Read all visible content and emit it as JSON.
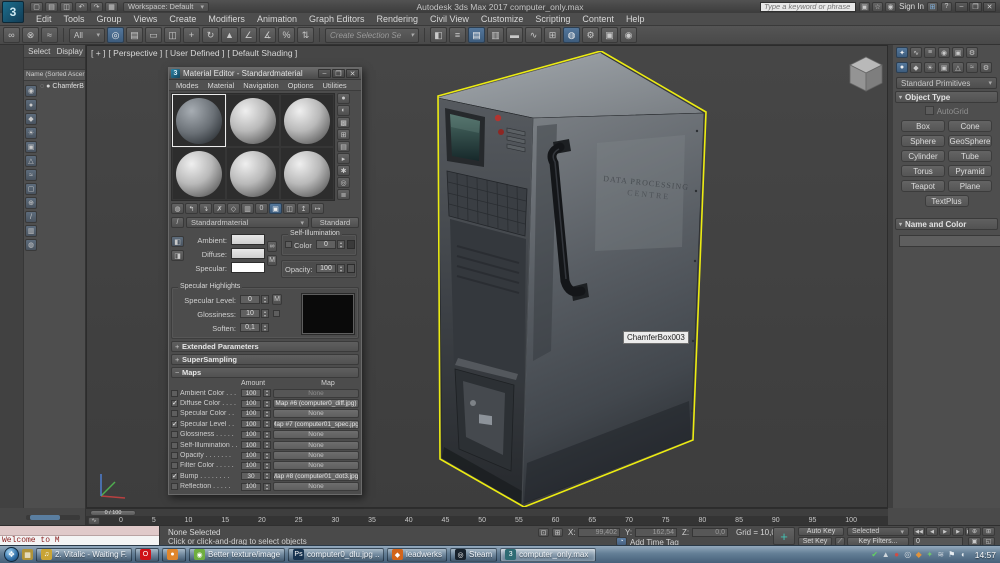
{
  "titlebar": {
    "workspace": "Workspace: Default",
    "title": "Autodesk 3ds Max 2017   computer_only.max",
    "search_placeholder": "Type a keyword or phrase",
    "sign_in": "Sign In",
    "quick_icons": [
      {
        "name": "new-scene-icon",
        "glyph": "▢"
      },
      {
        "name": "open-file-icon",
        "glyph": "▤"
      },
      {
        "name": "save-file-icon",
        "glyph": "◫"
      },
      {
        "name": "undo-icon",
        "glyph": "↶"
      },
      {
        "name": "redo-icon",
        "glyph": "↷"
      },
      {
        "name": "project-folder-icon",
        "glyph": "▦"
      }
    ],
    "right_icons": [
      {
        "name": "communication-center-icon",
        "glyph": "▣"
      },
      {
        "name": "favorites-icon",
        "glyph": "☆"
      },
      {
        "name": "profile-icon",
        "glyph": "◉"
      }
    ],
    "window_buttons": [
      {
        "name": "minimize-button",
        "glyph": "–"
      },
      {
        "name": "restore-button",
        "glyph": "❐"
      },
      {
        "name": "close-button",
        "glyph": "✕"
      }
    ]
  },
  "menubar": {
    "items": [
      "Edit",
      "Tools",
      "Group",
      "Views",
      "Create",
      "Modifiers",
      "Animation",
      "Graph Editors",
      "Rendering",
      "Civil View",
      "Customize",
      "Scripting",
      "Content",
      "Help"
    ]
  },
  "toolbar": {
    "left_icons": [
      {
        "name": "select-and-link-icon",
        "glyph": "∞"
      },
      {
        "name": "unlink-selection-icon",
        "glyph": "⊗"
      },
      {
        "name": "bind-to-space-warp-icon",
        "glyph": "≈"
      }
    ],
    "filter_label": "All",
    "mid_icons": [
      {
        "name": "select-object-icon",
        "glyph": "◎",
        "active": true
      },
      {
        "name": "select-by-name-icon",
        "glyph": "▤"
      },
      {
        "name": "rectangular-selection-region-icon",
        "glyph": "▭"
      },
      {
        "name": "window-crossing-icon",
        "glyph": "◫"
      },
      {
        "name": "select-and-move-icon",
        "glyph": "+"
      },
      {
        "name": "select-and-rotate-icon",
        "glyph": "↻"
      },
      {
        "name": "select-and-scale-icon",
        "glyph": "▲"
      },
      {
        "name": "snaps-toggle-icon",
        "glyph": "∠"
      },
      {
        "name": "angle-snap-icon",
        "glyph": "∡"
      },
      {
        "name": "percent-snap-icon",
        "glyph": "%"
      },
      {
        "name": "spinner-snap-icon",
        "glyph": "⇅"
      }
    ],
    "selection_set_placeholder": "Create Selection Se",
    "right_icons": [
      {
        "name": "mirror-icon",
        "glyph": "◧"
      },
      {
        "name": "align-icon",
        "glyph": "≡"
      },
      {
        "name": "toggle-scene-explorer-icon",
        "glyph": "▤",
        "active": true
      },
      {
        "name": "toggle-layer-explorer-icon",
        "glyph": "▥"
      },
      {
        "name": "toggle-ribbon-icon",
        "glyph": "▬"
      },
      {
        "name": "curve-editor-icon",
        "glyph": "∿"
      },
      {
        "name": "schematic-view-icon",
        "glyph": "⊞"
      },
      {
        "name": "material-editor-icon",
        "glyph": "◍",
        "active": true
      },
      {
        "name": "render-setup-icon",
        "glyph": "⚙"
      },
      {
        "name": "rendered-frame-window-icon",
        "glyph": "▣"
      },
      {
        "name": "render-production-icon",
        "glyph": "◉"
      }
    ]
  },
  "explorer": {
    "tabs": [
      "Select",
      "Display"
    ],
    "column_header": "Name (Sorted Ascer",
    "item": {
      "icon_a": "◌",
      "icon_b": "●",
      "label": "ChamferB"
    },
    "filter_icons": [
      {
        "name": "display-all-icon",
        "glyph": "◉"
      },
      {
        "name": "display-geometry-icon",
        "glyph": "●"
      },
      {
        "name": "display-shapes-icon",
        "glyph": "◆"
      },
      {
        "name": "display-lights-icon",
        "glyph": "☀"
      },
      {
        "name": "display-cameras-icon",
        "glyph": "▣"
      },
      {
        "name": "display-helpers-icon",
        "glyph": "△"
      },
      {
        "name": "display-spacewarps-icon",
        "glyph": "≈"
      },
      {
        "name": "display-groups-icon",
        "glyph": "▢"
      },
      {
        "name": "display-xrefs-icon",
        "glyph": "⊕"
      },
      {
        "name": "display-bones-icon",
        "glyph": "/"
      },
      {
        "name": "display-containers-icon",
        "glyph": "▥"
      },
      {
        "name": "display-materials-icon",
        "glyph": "◍"
      }
    ]
  },
  "viewport": {
    "label_parts": [
      "[ + ]",
      "[ Perspective ]",
      "[ User Defined ]",
      "[ Default Shading ]"
    ],
    "tooltip": "ChamferBox003",
    "machine_label_1": "DATA PROCESSING",
    "machine_label_2": "CENTRE",
    "selection_color": "#ecec12"
  },
  "material_editor": {
    "title": "Material Editor - Standardmaterial",
    "menus": [
      "Modes",
      "Material",
      "Navigation",
      "Options",
      "Utilities"
    ],
    "window_buttons": [
      {
        "name": "minimize-button",
        "glyph": "–"
      },
      {
        "name": "restore-button",
        "glyph": "❐"
      },
      {
        "name": "close-button",
        "glyph": "✕"
      }
    ],
    "vtools": [
      {
        "name": "sample-type-icon",
        "glyph": "●"
      },
      {
        "name": "backlight-icon",
        "glyph": "◐"
      },
      {
        "name": "background-icon",
        "glyph": "▩"
      },
      {
        "name": "sample-uv-tiling-icon",
        "glyph": "⊞"
      },
      {
        "name": "video-color-check-icon",
        "glyph": "▤"
      },
      {
        "name": "make-preview-icon",
        "glyph": "▸"
      },
      {
        "name": "options-icon",
        "glyph": "✱"
      },
      {
        "name": "select-by-material-icon",
        "glyph": "◎"
      },
      {
        "name": "material-map-navigator-icon",
        "glyph": "≣"
      }
    ],
    "htools": [
      {
        "name": "get-material-icon",
        "glyph": "◍"
      },
      {
        "name": "put-to-scene-icon",
        "glyph": "↰"
      },
      {
        "name": "assign-material-to-selection-icon",
        "glyph": "↴"
      },
      {
        "name": "reset-map-icon",
        "glyph": "✗"
      },
      {
        "name": "make-material-copy-icon",
        "glyph": "◇"
      },
      {
        "name": "put-to-library-icon",
        "glyph": "▥"
      },
      {
        "name": "material-id-channel-icon",
        "glyph": "0"
      },
      {
        "name": "show-map-in-viewport-icon",
        "glyph": "▣",
        "active": true
      },
      {
        "name": "show-end-result-icon",
        "glyph": "◫"
      },
      {
        "name": "go-to-parent-icon",
        "glyph": "↥"
      },
      {
        "name": "go-forward-to-sibling-icon",
        "glyph": "↦"
      }
    ],
    "material_name": "Standardmaterial",
    "material_type": "Standard",
    "basic": {
      "ambient_label": "Ambient:",
      "diffuse_label": "Diffuse:",
      "specular_label": "Specular:",
      "m_button": "M",
      "self_illum_title": "Self-Illumination",
      "color_label": "Color",
      "color_value": "0",
      "opacity_label": "Opacity:",
      "opacity_value": "100"
    },
    "highlights": {
      "title": "Specular Highlights",
      "specular_level_label": "Specular Level:",
      "specular_level_value": "0",
      "m_button": "M",
      "glossiness_label": "Glossiness:",
      "glossiness_value": "10",
      "soften_label": "Soften:",
      "soften_value": "0,1"
    },
    "rollout_extended": "Extended Parameters",
    "rollout_supersampling": "SuperSampling",
    "rollout_maps": "Maps",
    "maps": {
      "amount_header": "Amount",
      "map_header": "Map",
      "rows": [
        {
          "checked": false,
          "label": "Ambient Color . . .",
          "amount": "100",
          "map": "None",
          "is_none": true,
          "disabled": true
        },
        {
          "checked": true,
          "label": "Diffuse Color . . . .",
          "amount": "100",
          "map": "Map #6 (computer0_diff.jpg)",
          "is_none": false
        },
        {
          "checked": false,
          "label": "Specular Color . .",
          "amount": "100",
          "map": "None",
          "is_none": true
        },
        {
          "checked": true,
          "label": "Specular Level . .",
          "amount": "100",
          "map": "Map #7 (computer01_spec.jpg)",
          "is_none": false
        },
        {
          "checked": false,
          "label": "Glossiness . . . . .",
          "amount": "100",
          "map": "None",
          "is_none": true
        },
        {
          "checked": false,
          "label": "Self-Illumination . .",
          "amount": "100",
          "map": "None",
          "is_none": true
        },
        {
          "checked": false,
          "label": "Opacity . . . . . . .",
          "amount": "100",
          "map": "None",
          "is_none": true
        },
        {
          "checked": false,
          "label": "Filter Color . . . . .",
          "amount": "100",
          "map": "None",
          "is_none": true
        },
        {
          "checked": true,
          "label": "Bump . . . . . . . .",
          "amount": "30",
          "map": "Map #8 (computer01_dot3.jpg)",
          "is_none": false
        },
        {
          "checked": false,
          "label": "Reflection . . . . .",
          "amount": "100",
          "map": "None",
          "is_none": true
        }
      ]
    }
  },
  "command_panel": {
    "tab_icons": [
      {
        "name": "create-tab-icon",
        "glyph": "✦",
        "active": true
      },
      {
        "name": "modify-tab-icon",
        "glyph": "∿"
      },
      {
        "name": "hierarchy-tab-icon",
        "glyph": "≡"
      },
      {
        "name": "motion-tab-icon",
        "glyph": "◉"
      },
      {
        "name": "display-tab-icon",
        "glyph": "▣"
      },
      {
        "name": "utilities-tab-icon",
        "glyph": "⚙"
      }
    ],
    "subcat_icons": [
      {
        "name": "geometry-category-icon",
        "glyph": "●",
        "active": true
      },
      {
        "name": "shapes-category-icon",
        "glyph": "◆"
      },
      {
        "name": "lights-category-icon",
        "glyph": "☀"
      },
      {
        "name": "cameras-category-icon",
        "glyph": "▣"
      },
      {
        "name": "helpers-category-icon",
        "glyph": "△"
      },
      {
        "name": "space-warps-category-icon",
        "glyph": "≈"
      },
      {
        "name": "systems-category-icon",
        "glyph": "⚙"
      }
    ],
    "category": "Standard Primitives",
    "object_type_title": "Object Type",
    "autogrid_label": "AutoGrid",
    "buttons": [
      "Box",
      "Cone",
      "Sphere",
      "GeoSphere",
      "Cylinder",
      "Tube",
      "Torus",
      "Pyramid",
      "Teapot",
      "Plane",
      "TextPlus"
    ],
    "name_color_title": "Name and Color"
  },
  "timeline": {
    "slider_label": "0 / 100",
    "ticks": [
      "0",
      "5",
      "10",
      "15",
      "20",
      "25",
      "30",
      "35",
      "40",
      "45",
      "50",
      "55",
      "60",
      "65",
      "70",
      "75",
      "80",
      "85",
      "90",
      "95",
      "100"
    ]
  },
  "statusbar": {
    "listener_text": "Welcome to M",
    "selection_status": "None Selected",
    "prompt": "Click or click-and-drag to select objects",
    "x_label": "X:",
    "x_value": "99,402",
    "y_label": "Y:",
    "y_value": "162,54",
    "z_label": "Z:",
    "z_value": "0,0",
    "grid_label": "Grid = 10,0",
    "add_time_tag": "Add Time Tag",
    "auto_key": "Auto Key",
    "set_key": "Set Key",
    "selected_dropdown": "Selected",
    "key_filters": "Key Filters...",
    "frame_value": "0",
    "playback": [
      {
        "name": "go-to-start-button",
        "glyph": "◀◀"
      },
      {
        "name": "previous-frame-button",
        "glyph": "◀"
      },
      {
        "name": "play-button",
        "glyph": "▶"
      },
      {
        "name": "next-frame-button",
        "glyph": "▶"
      },
      {
        "name": "go-to-end-button",
        "glyph": "▶▶"
      }
    ],
    "nav_icons": [
      {
        "name": "zoom-icon",
        "glyph": "⊕"
      },
      {
        "name": "zoom-all-icon",
        "glyph": "⊞"
      },
      {
        "name": "zoom-extents-icon",
        "glyph": "▣"
      },
      {
        "name": "zoom-region-icon",
        "glyph": "◱"
      },
      {
        "name": "pan-icon",
        "glyph": "↔"
      },
      {
        "name": "orbit-icon",
        "glyph": "↻"
      },
      {
        "name": "field-of-view-icon",
        "glyph": "◿"
      },
      {
        "name": "maximize-viewport-toggle-icon",
        "glyph": "◰"
      }
    ]
  },
  "taskbar": {
    "pinned_glyph": "▦",
    "items": [
      {
        "icon_name": "media-player-icon",
        "glyph": "♫",
        "color": "#c9a435",
        "label": "2. Vitalic - Waiting F...",
        "icon_only": false
      },
      {
        "icon_name": "opera-icon",
        "glyph": "O",
        "color": "#cf1117",
        "label": "",
        "icon_only": true
      },
      {
        "icon_name": "browser-icon",
        "glyph": "●",
        "color": "#e0862c",
        "label": "",
        "icon_only": true
      },
      {
        "icon_name": "chrome-icon",
        "glyph": "◉",
        "color": "#6fae3f",
        "label": "Better texture/image ...",
        "icon_only": false
      },
      {
        "icon_name": "photoshop-icon",
        "glyph": "Ps",
        "color": "#16324f",
        "label": "computer0_dlu.jpg ...",
        "icon_only": false
      },
      {
        "icon_name": "leadwerks-icon",
        "glyph": "◆",
        "color": "#d2641a",
        "label": "leadwerks",
        "icon_only": false
      },
      {
        "icon_name": "steam-icon",
        "glyph": "◎",
        "color": "#17212b",
        "label": "Steam",
        "icon_only": false
      },
      {
        "icon_name": "3dsmax-icon",
        "glyph": "3",
        "color": "#2e6b73",
        "label": "computer_only.max ...",
        "icon_only": false,
        "active": true
      }
    ],
    "tray_icons": [
      {
        "name": "tray-antivirus-icon",
        "glyph": "✔",
        "color": "#62d162"
      },
      {
        "name": "tray-update-icon",
        "glyph": "▲",
        "color": "#cfd6dc"
      },
      {
        "name": "tray-app-red-icon",
        "glyph": "●",
        "color": "#d24b43"
      },
      {
        "name": "tray-steam-icon",
        "glyph": "◎",
        "color": "#cfd6dc"
      },
      {
        "name": "tray-app-orange-icon",
        "glyph": "◆",
        "color": "#e0933c"
      },
      {
        "name": "tray-app-green-icon",
        "glyph": "✦",
        "color": "#6fc56f"
      },
      {
        "name": "tray-network-icon",
        "glyph": "≋",
        "color": "#cfd6dc"
      },
      {
        "name": "tray-action-center-icon",
        "glyph": "⚑",
        "color": "#e8eef2"
      },
      {
        "name": "volume-icon",
        "glyph": "◖",
        "color": "#e8eef2"
      }
    ],
    "clock": "14:57"
  }
}
